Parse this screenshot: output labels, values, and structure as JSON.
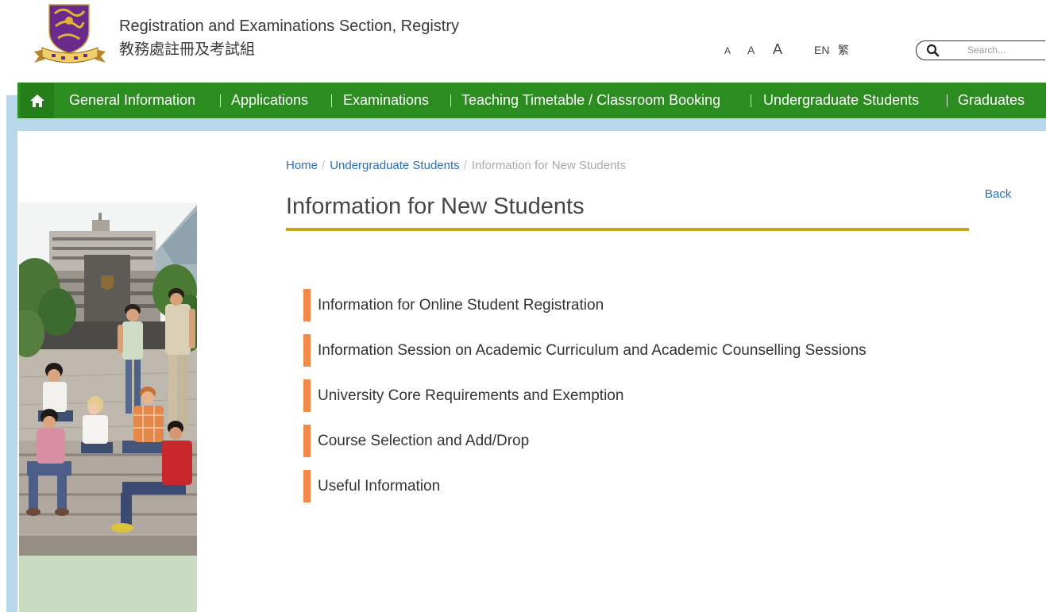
{
  "header": {
    "title_en": "Registration and Examinations Section, Registry",
    "title_zh": "教務處註冊及考試組",
    "font_size_controls": [
      "A",
      "A",
      "A"
    ],
    "languages": [
      "EN",
      "繁"
    ],
    "search": {
      "placeholder": "Search...",
      "value": ""
    }
  },
  "nav": {
    "items": [
      "General Information",
      "Applications",
      "Examinations",
      "Teaching Timetable / Classroom Booking",
      "Undergraduate Students",
      "Graduates"
    ]
  },
  "breadcrumb": {
    "separator": "/",
    "items": [
      "Home",
      "Undergraduate Students",
      "Information for New Students"
    ]
  },
  "back_label": "Back",
  "page": {
    "title": "Information for New Students",
    "links": [
      "Information for Online Student Registration",
      "Information Session on Academic Curriculum and Academic Counselling Sessions",
      "University Core Requirements and Exemption",
      "Course Selection and Add/Drop",
      "Useful Information"
    ]
  },
  "icons": {
    "logo": "cuhk-crest-logo",
    "home": "home-icon",
    "search": "search-icon",
    "sidebar_image": "campus-students-photo"
  },
  "colors": {
    "nav_green": "#2b8c1f",
    "link_blue": "#2a6fb6",
    "title_rule_gold": "#c9a21e",
    "list_bar_orange": "#f08a4b",
    "frame_light_blue": "#b9d7ea",
    "sidebar_green": "#c9dcc2"
  }
}
